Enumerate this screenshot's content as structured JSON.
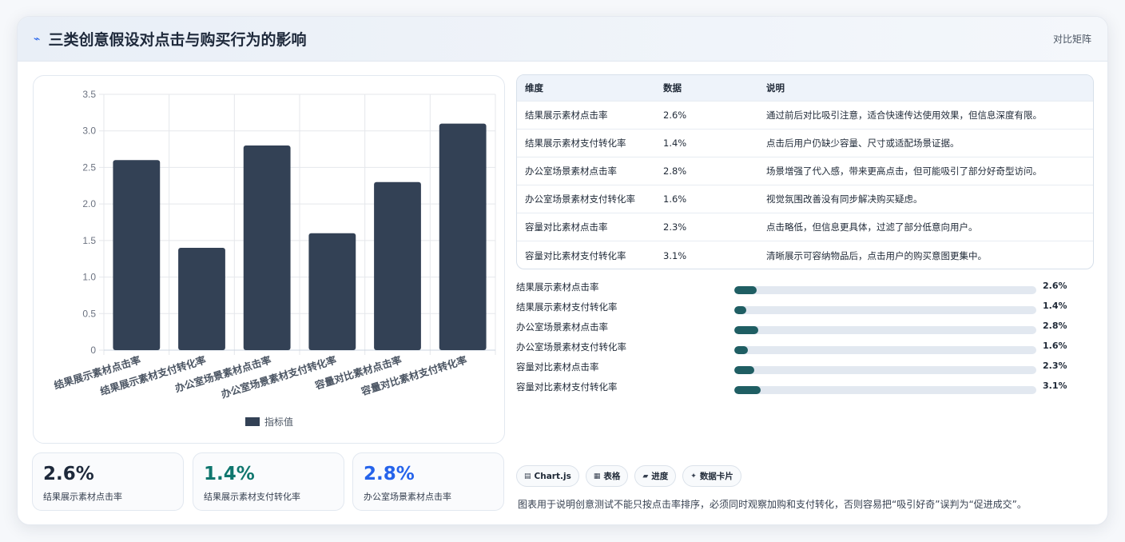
{
  "header": {
    "icon": "sparkline-icon",
    "title": "三类创意假设对点击与购买行为的影响",
    "tag": "对比矩阵"
  },
  "chart_data": {
    "type": "bar",
    "categories": [
      "结果展示素材点击率",
      "结果展示素材支付转化率",
      "办公室场景素材点击率",
      "办公室场景素材支付转化率",
      "容量对比素材点击率",
      "容量对比素材支付转化率"
    ],
    "series": [
      {
        "name": "指标值",
        "values": [
          2.6,
          1.4,
          2.8,
          1.6,
          2.3,
          3.1
        ]
      }
    ],
    "yticks": [
      "0",
      "0.5",
      "1.0",
      "1.5",
      "2.0",
      "2.5",
      "3.0",
      "3.5"
    ],
    "ylim": [
      0,
      3.5
    ],
    "grid": true,
    "legend_position": "bottom",
    "bar_color": "#334155"
  },
  "stats": [
    {
      "value": "2.6%",
      "label": "结果展示素材点击率",
      "color": "#1e293b"
    },
    {
      "value": "1.4%",
      "label": "结果展示素材支付转化率",
      "color": "#0f766e"
    },
    {
      "value": "2.8%",
      "label": "办公室场景素材点击率",
      "color": "#2563eb"
    }
  ],
  "table": {
    "headers": [
      "维度",
      "数据",
      "说明"
    ],
    "rows": [
      [
        "结果展示素材点击率",
        "2.6%",
        "通过前后对比吸引注意，适合快速传达使用效果，但信息深度有限。"
      ],
      [
        "结果展示素材支付转化率",
        "1.4%",
        "点击后用户仍缺少容量、尺寸或适配场景证据。"
      ],
      [
        "办公室场景素材点击率",
        "2.8%",
        "场景增强了代入感，带来更高点击，但可能吸引了部分好奇型访问。"
      ],
      [
        "办公室场景素材支付转化率",
        "1.6%",
        "视觉氛围改善没有同步解决购买疑虑。"
      ],
      [
        "容量对比素材点击率",
        "2.3%",
        "点击略低，但信息更具体，过滤了部分低意向用户。"
      ],
      [
        "容量对比素材支付转化率",
        "3.1%",
        "清晰展示可容纳物品后，点击用户的购买意图更集中。"
      ]
    ]
  },
  "progress": [
    {
      "label": "结果展示素材点击率",
      "value": "2.6%"
    },
    {
      "label": "结果展示素材支付转化率",
      "value": "1.4%"
    },
    {
      "label": "办公室场景素材点击率",
      "value": "2.8%"
    },
    {
      "label": "办公室场景素材支付转化率",
      "value": "1.6%"
    },
    {
      "label": "容量对比素材点击率",
      "value": "2.3%"
    },
    {
      "label": "容量对比素材支付转化率",
      "value": "3.1%"
    }
  ],
  "chips": [
    {
      "icon": "chart-icon",
      "glyph": "▤",
      "label": "Chart.js"
    },
    {
      "icon": "table-icon",
      "glyph": "▦",
      "label": "表格"
    },
    {
      "icon": "progress-icon",
      "glyph": "▰",
      "label": "进度"
    },
    {
      "icon": "sparkle-icon",
      "glyph": "✦",
      "label": "数据卡片"
    }
  ],
  "note": "图表用于说明创意测试不能只按点击率排序，必须同时观察加购和支付转化，否则容易把“吸引好奇”误判为“促进成交”。"
}
